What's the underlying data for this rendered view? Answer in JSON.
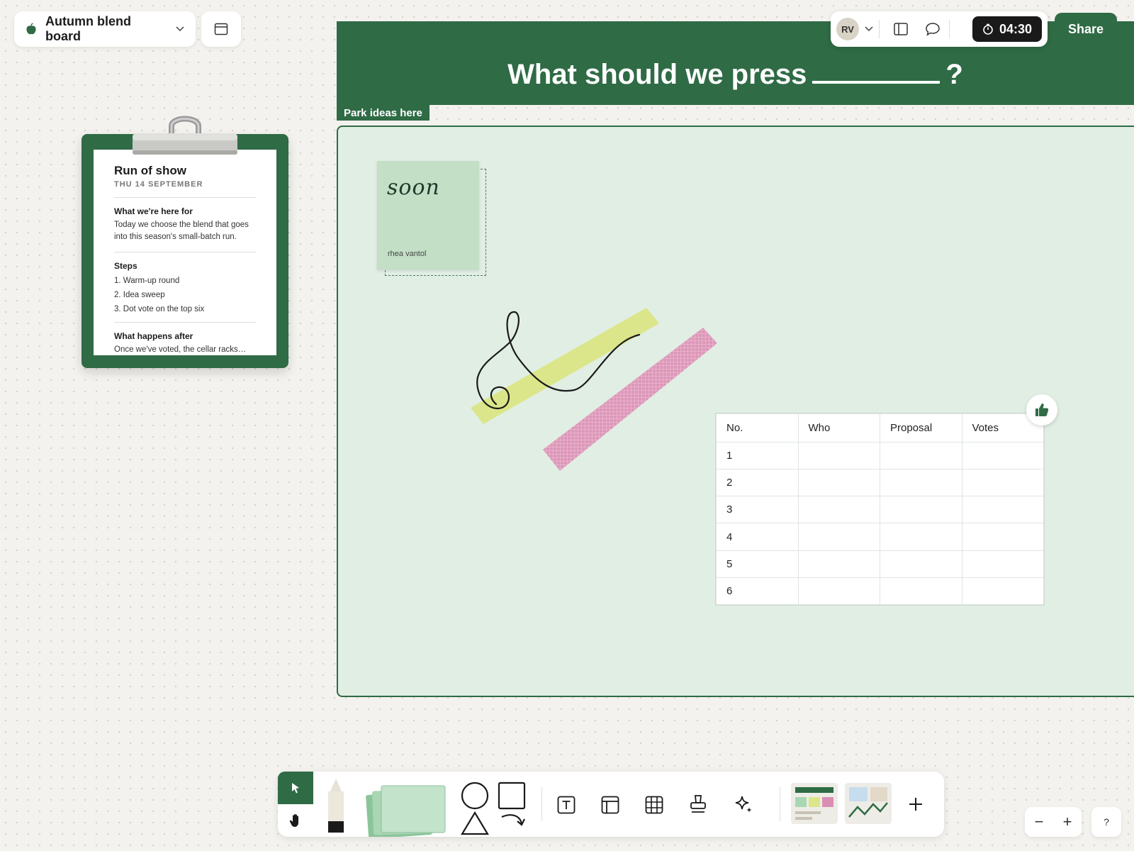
{
  "board": {
    "title": "Autumn blend board"
  },
  "header": {
    "question": "What should we press",
    "question_end": "?"
  },
  "park_zone": {
    "label": "Park ideas here"
  },
  "top_tools": {
    "avatar_initials": "RV",
    "timer": "04:30",
    "share_label": "Share"
  },
  "clipboard": {
    "title": "Run of show",
    "date": "THU 14 SEPTEMBER",
    "sections": [
      {
        "heading": "What we're here for",
        "body": "Today we choose the blend that goes into this season's small-batch run."
      },
      {
        "heading": "Steps",
        "items": [
          "1. Warm-up round",
          "2. Idea sweep",
          "3. Dot vote on the top six"
        ]
      },
      {
        "heading": "What happens after",
        "body": "Once we've voted, the cellar racks…"
      }
    ]
  },
  "sticky": {
    "text": "soon",
    "author": "rhea vantol",
    "color": "#c3dfc6"
  },
  "vote_table": {
    "headers": [
      "No.",
      "Who",
      "Proposal",
      "Votes"
    ],
    "rows": [
      "1",
      "2",
      "3",
      "4",
      "5",
      "6"
    ]
  },
  "zoom": {
    "out": "−",
    "in": "+"
  },
  "help": {
    "label": "?"
  },
  "colors": {
    "brand": "#2f6b45",
    "zone": "#e1eee4",
    "tape_yellow": "#dbe68a",
    "tape_pink": "#d98fb3"
  }
}
